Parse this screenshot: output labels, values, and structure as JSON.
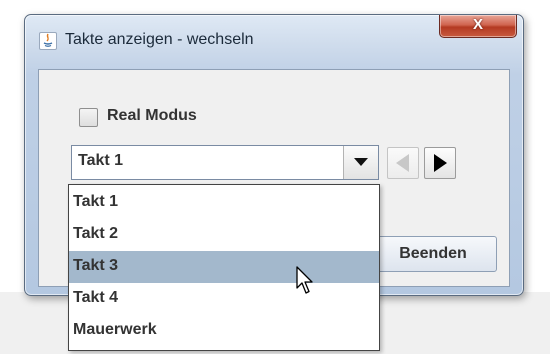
{
  "window": {
    "title": "Takte anzeigen - wechseln",
    "close_label": "X",
    "app_icon": "java-icon"
  },
  "options": {
    "real_mode_label": "Real Modus",
    "real_mode_checked": false
  },
  "combo": {
    "selected": "Takt 1",
    "items": [
      "Takt 1",
      "Takt 2",
      "Takt 3",
      "Takt 4",
      "Mauerwerk"
    ],
    "highlighted_index": 2
  },
  "navigation": {
    "prev_icon": "triangle-left-icon",
    "prev_enabled": false,
    "next_icon": "triangle-right-icon",
    "next_enabled": true
  },
  "actions": {
    "quit_label": "Beenden"
  },
  "colors": {
    "highlight": "#a3b8cc",
    "close_button": "#c85a3f"
  }
}
